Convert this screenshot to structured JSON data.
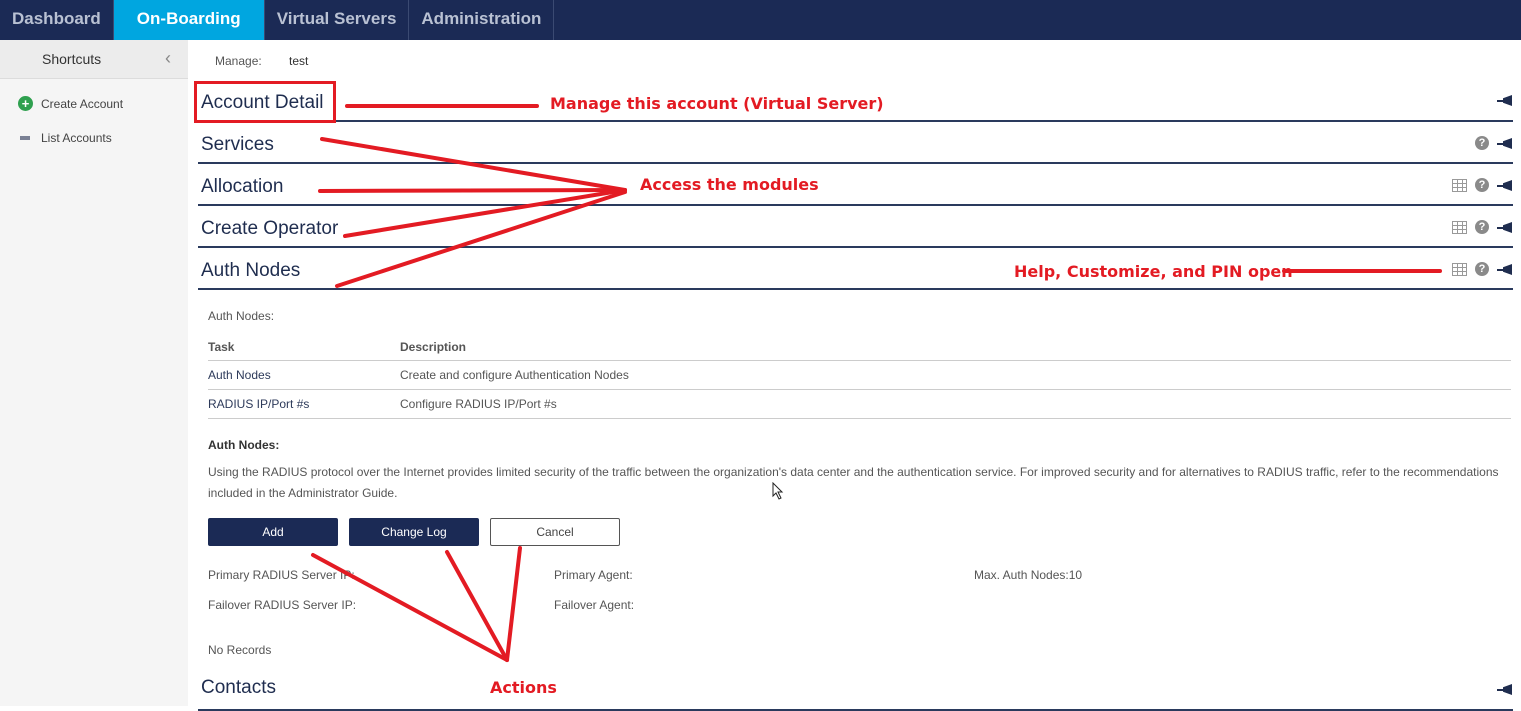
{
  "topnav": {
    "tabs": [
      {
        "label": "Dashboard",
        "active": false
      },
      {
        "label": "On-Boarding",
        "active": true
      },
      {
        "label": "Virtual Servers",
        "active": false
      },
      {
        "label": "Administration",
        "active": false
      }
    ]
  },
  "sidebar": {
    "title": "Shortcuts",
    "collapse_icon": "chevron-left-icon",
    "items": [
      {
        "label": "Create Account",
        "icon": "plus-circle-icon"
      },
      {
        "label": "List Accounts",
        "icon": "list-icon"
      }
    ]
  },
  "main": {
    "manage_label": "Manage:",
    "manage_value": "test",
    "sections": [
      {
        "title": "Account Detail",
        "icons": [
          "pin-icon"
        ]
      },
      {
        "title": "Services",
        "icons": [
          "help-icon",
          "pin-icon"
        ]
      },
      {
        "title": "Allocation",
        "icons": [
          "grid-icon",
          "help-icon",
          "pin-icon"
        ]
      },
      {
        "title": "Create Operator",
        "icons": [
          "grid-icon",
          "help-icon",
          "pin-icon"
        ]
      },
      {
        "title": "Auth Nodes",
        "icons": [
          "grid-icon",
          "help-icon",
          "pin-icon"
        ]
      },
      {
        "title": "Contacts",
        "icons": [
          "pin-icon"
        ]
      }
    ],
    "auth_nodes": {
      "intro_label": "Auth Nodes:",
      "table": {
        "headers": [
          "Task",
          "Description"
        ],
        "rows": [
          [
            "Auth Nodes",
            "Create and configure Authentication Nodes"
          ],
          [
            "RADIUS IP/Port #s",
            "Configure RADIUS IP/Port #s"
          ]
        ]
      },
      "info_heading": "Auth Nodes:",
      "info_text": "Using the RADIUS protocol over the Internet provides limited security of the traffic between the organization's data center and the authentication service. For improved security and for alternatives to RADIUS traffic, refer to the recommendations included in the Administrator Guide.",
      "buttons": {
        "add": "Add",
        "change_log": "Change Log",
        "cancel": "Cancel"
      },
      "fields": {
        "primary_radius": "Primary RADIUS Server IP:",
        "failover_radius": "Failover RADIUS Server IP:",
        "primary_agent": "Primary Agent:",
        "failover_agent": "Failover Agent:",
        "max_nodes": "Max. Auth Nodes:10"
      },
      "no_records": "No Records"
    }
  },
  "annotations": {
    "manage_account": "Manage this account (Virtual Server)",
    "access_modules": "Access the modules",
    "help_customize": "Help, Customize, and PIN open",
    "actions": "Actions",
    "color": "#e31b23"
  }
}
